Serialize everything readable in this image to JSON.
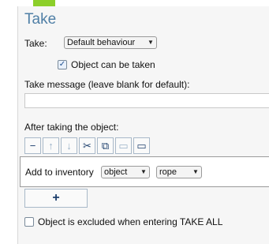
{
  "panel": {
    "title": "Take",
    "take_label": "Take:",
    "take_select_value": "Default behaviour",
    "object_can_be_taken_label": "Object can be taken",
    "object_can_be_taken_checked": true,
    "take_message_label": "Take message (leave blank for default):",
    "take_message_value": "",
    "after_taking_label": "After taking the object:",
    "toolbar": {
      "remove_glyph": "−",
      "up_glyph": "↑",
      "down_glyph": "↓",
      "cut_glyph": "✂",
      "copy_glyph": "⧉",
      "paste_glyph": "▭",
      "code_view_glyph": "▭"
    },
    "script_row": {
      "command_label": "Add to inventory",
      "object_select_value": "object",
      "item_select_value": "rope"
    },
    "add_button_label": "+",
    "exclude_take_all_label": "Object is excluded when entering TAKE ALL",
    "exclude_take_all_checked": false
  },
  "colors": {
    "accent": "#8ccf2a",
    "title": "#4f7fa6",
    "panel_bg": "#f6f6f6"
  }
}
